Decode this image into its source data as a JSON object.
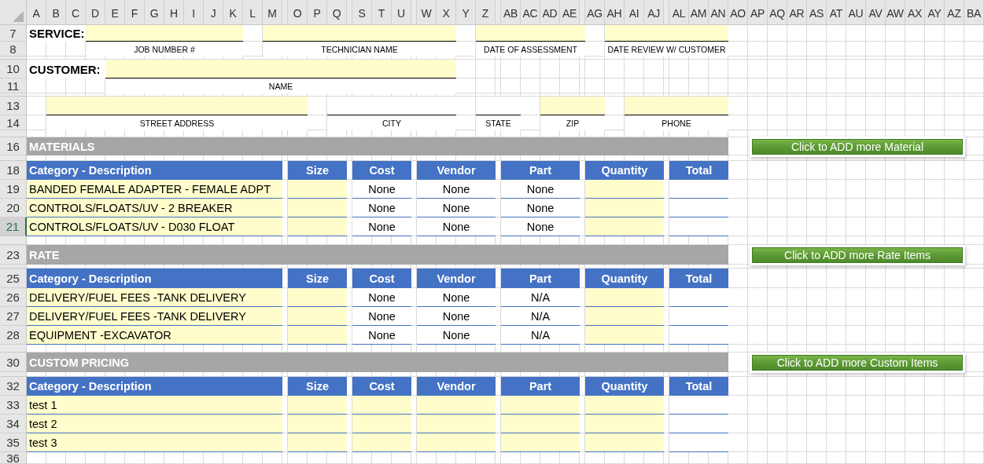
{
  "sheet": {
    "columns": [
      {
        "label": "A"
      },
      {
        "label": "B"
      },
      {
        "label": "C"
      },
      {
        "label": "D"
      },
      {
        "label": "E"
      },
      {
        "label": "F"
      },
      {
        "label": "G"
      },
      {
        "label": "H"
      },
      {
        "label": "I"
      },
      {
        "label": "J"
      },
      {
        "label": "K"
      },
      {
        "label": "L"
      },
      {
        "label": "M"
      },
      {
        "kind": "narrow"
      },
      {
        "label": "O"
      },
      {
        "label": "P"
      },
      {
        "label": "Q"
      },
      {
        "kind": "narrow"
      },
      {
        "label": "S"
      },
      {
        "label": "T"
      },
      {
        "label": "U"
      },
      {
        "kind": "narrow"
      },
      {
        "label": "W"
      },
      {
        "label": "X"
      },
      {
        "label": "Y"
      },
      {
        "label": "Z"
      },
      {
        "kind": "narrow"
      },
      {
        "label": "AB"
      },
      {
        "label": "AC"
      },
      {
        "label": "AD"
      },
      {
        "label": "AE"
      },
      {
        "kind": "narrow"
      },
      {
        "label": "AG"
      },
      {
        "label": "AH"
      },
      {
        "label": "AI"
      },
      {
        "label": "AJ"
      },
      {
        "kind": "narrow"
      },
      {
        "label": "AL"
      },
      {
        "label": "AM"
      },
      {
        "label": "AN"
      },
      {
        "label": "AO"
      },
      {
        "label": "AP"
      },
      {
        "label": "AQ"
      },
      {
        "label": "AR"
      },
      {
        "label": "AS"
      },
      {
        "label": "AT"
      },
      {
        "label": "AU"
      },
      {
        "label": "AV"
      },
      {
        "label": "AW"
      },
      {
        "label": "AX"
      },
      {
        "label": "AY"
      },
      {
        "label": "AZ"
      },
      {
        "label": "BA"
      }
    ],
    "row_numbers": [
      {
        "label": "7",
        "selected": false
      },
      {
        "label": "8",
        "selected": false
      },
      {
        "kind": "thin",
        "selected": false
      },
      {
        "label": "10",
        "selected": false
      },
      {
        "label": "11",
        "selected": false
      },
      {
        "kind": "thin",
        "selected": false
      },
      {
        "label": "13",
        "selected": false
      },
      {
        "label": "14",
        "selected": false
      },
      {
        "kind": "thin",
        "selected": false
      },
      {
        "label": "16",
        "selected": false
      },
      {
        "kind": "thin",
        "selected": false
      },
      {
        "label": "18",
        "selected": false
      },
      {
        "label": "19",
        "selected": false
      },
      {
        "label": "20",
        "selected": false
      },
      {
        "label": "21",
        "selected": true
      },
      {
        "kind": "thin",
        "selected": false
      },
      {
        "label": "23",
        "selected": false
      },
      {
        "kind": "thin",
        "selected": false
      },
      {
        "label": "25",
        "selected": false
      },
      {
        "label": "26",
        "selected": false
      },
      {
        "label": "27",
        "selected": false
      },
      {
        "label": "28",
        "selected": false
      },
      {
        "kind": "thin",
        "selected": false
      },
      {
        "label": "30",
        "selected": false
      },
      {
        "kind": "thin",
        "selected": false
      },
      {
        "label": "32",
        "selected": false
      },
      {
        "label": "33",
        "selected": false
      },
      {
        "label": "34",
        "selected": false
      },
      {
        "label": "35",
        "selected": false
      },
      {
        "label": "36",
        "selected": false
      }
    ]
  },
  "form": {
    "service_label": "SERVICE:",
    "customer_label": "CUSTOMER:",
    "fields": [
      {
        "label": "JOB NUMBER #",
        "shaded": true
      },
      {
        "label": "TECHNICIAN NAME",
        "shaded": true
      },
      {
        "label": "DATE OF ASSESSMENT",
        "shaded": true
      },
      {
        "label": "DATE REVIEW W/ CUSTOMER",
        "shaded": true
      },
      {
        "label": "NAME",
        "shaded": true
      },
      {
        "label": "STREET ADDRESS",
        "shaded": true
      },
      {
        "label": "CITY",
        "shaded": false
      },
      {
        "label": "STATE",
        "shaded": false
      },
      {
        "label": "ZIP",
        "shaded": true
      },
      {
        "label": "PHONE",
        "shaded": true
      }
    ]
  },
  "sections": [
    {
      "title": "MATERIALS",
      "button": "Click to ADD more Material",
      "headers": [
        "Category - Description",
        "Size",
        "Cost",
        "Vendor",
        "Part",
        "Quantity",
        "Total"
      ],
      "rows": [
        {
          "description": "BANDED FEMALE ADAPTER - FEMALE ADPT",
          "cost": "None",
          "vendor": "None",
          "part": "None"
        },
        {
          "description": "CONTROLS/FLOATS/UV - 2 BREAKER",
          "cost": "None",
          "vendor": "None",
          "part": "None"
        },
        {
          "description": "CONTROLS/FLOATS/UV - D030 FLOAT",
          "cost": "None",
          "vendor": "None",
          "part": "None"
        }
      ]
    },
    {
      "title": "RATE",
      "button": "Click to ADD more Rate Items",
      "headers": [
        "Category - Description",
        "Size",
        "Cost",
        "Vendor",
        "Part",
        "Quantity",
        "Total"
      ],
      "rows": [
        {
          "description": "DELIVERY/FUEL FEES -TANK DELIVERY",
          "cost": "None",
          "vendor": "None",
          "part": "N/A"
        },
        {
          "description": "DELIVERY/FUEL FEES -TANK DELIVERY",
          "cost": "None",
          "vendor": "None",
          "part": "N/A"
        },
        {
          "description": "EQUIPMENT -EXCAVATOR",
          "cost": "None",
          "vendor": "None",
          "part": "N/A"
        }
      ]
    },
    {
      "title": "CUSTOM PRICING",
      "button": "Click to ADD more Custom Items",
      "headers": [
        "Category - Description",
        "Size",
        "Cost",
        "Vendor",
        "Part",
        "Quantity",
        "Total"
      ],
      "rows": [
        {
          "description": "test 1"
        },
        {
          "description": "test 2"
        },
        {
          "description": "test 3"
        }
      ]
    }
  ]
}
